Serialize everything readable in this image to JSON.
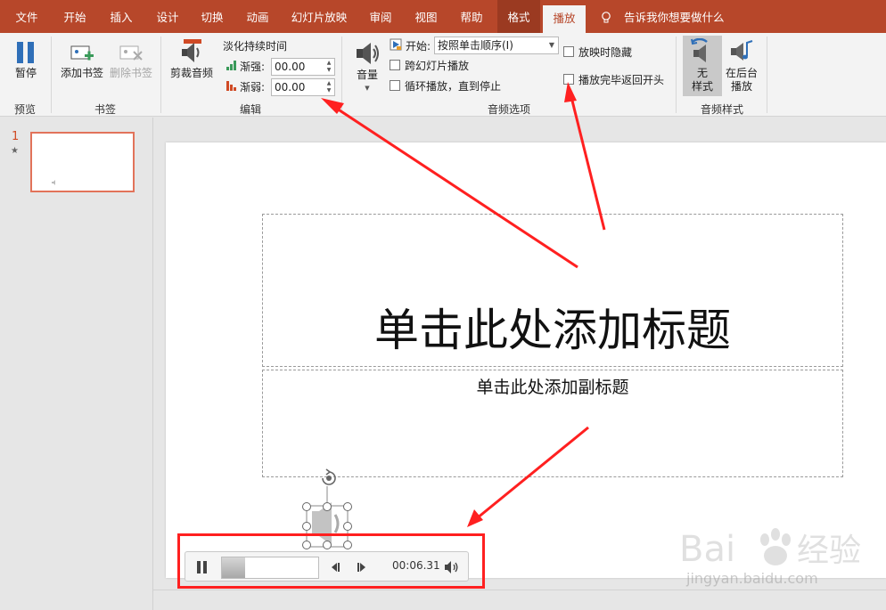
{
  "tabs": [
    {
      "label": "文件"
    },
    {
      "label": "开始"
    },
    {
      "label": "插入"
    },
    {
      "label": "设计"
    },
    {
      "label": "切换"
    },
    {
      "label": "动画"
    },
    {
      "label": "幻灯片放映"
    },
    {
      "label": "审阅"
    },
    {
      "label": "视图"
    },
    {
      "label": "帮助"
    },
    {
      "label": "格式"
    },
    {
      "label": "播放"
    }
  ],
  "tell_me": "告诉我你想要做什么",
  "ribbon": {
    "preview": {
      "pause_label": "暂停",
      "group_label": "预览"
    },
    "bookmarks": {
      "add_label": "添加书签",
      "remove_label": "删除书签",
      "group_label": "书签"
    },
    "editing": {
      "trim_label": "剪裁音频",
      "fade_label": "淡化持续时间",
      "fade_in_label": "渐强:",
      "fade_in_value": "00.00",
      "fade_out_label": "渐弱:",
      "fade_out_value": "00.00",
      "group_label": "编辑"
    },
    "audio_options": {
      "volume_label": "音量",
      "start_label": "开始:",
      "start_value": "按照单击顺序(I)",
      "play_across_label": "跨幻灯片播放",
      "loop_label": "循环播放，直到停止",
      "hide_label": "放映时隐藏",
      "rewind_label": "播放完毕返回开头",
      "group_label": "音频选项"
    },
    "audio_styles": {
      "no_style_label1": "无",
      "no_style_label2": "样式",
      "background_label1": "在后台",
      "background_label2": "播放",
      "group_label": "音频样式"
    }
  },
  "thumbnails": [
    {
      "number": "1",
      "star": "★"
    }
  ],
  "slide": {
    "title": "单击此处添加标题",
    "subtitle": "单击此处添加副标题"
  },
  "player": {
    "time": "00:06.31",
    "progress": 0.24
  },
  "watermark": {
    "text": "jingyan.baidu.com"
  },
  "colors": {
    "accent": "#b7472a",
    "annotation": "#ff2020"
  }
}
